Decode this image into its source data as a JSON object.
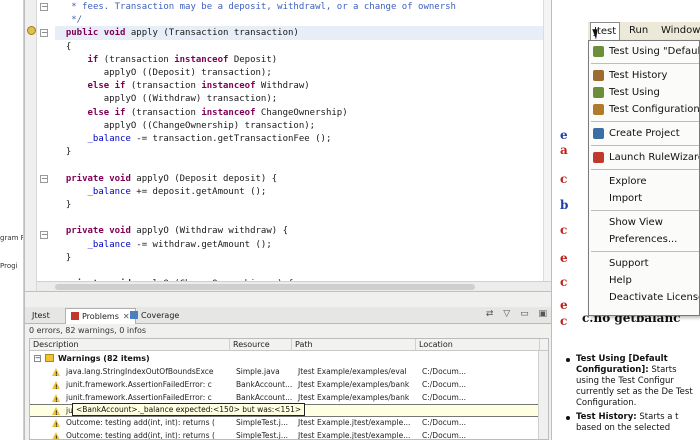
{
  "left_strip": {
    "text1": "gram F",
    "text2": "Progi"
  },
  "editor": {
    "lines": [
      [
        {
          "t": "   ",
          "c": ""
        },
        {
          "t": "* fees. Transaction may be a deposit, withdrawl, or a change of ownersh",
          "c": "cm"
        }
      ],
      [
        {
          "t": "   ",
          "c": ""
        },
        {
          "t": "*/",
          "c": "cm"
        }
      ],
      [
        {
          "t": "  ",
          "c": ""
        },
        {
          "t": "public void",
          "c": "kw"
        },
        {
          "t": " apply (Transaction transaction)",
          "c": ""
        }
      ],
      [
        {
          "t": "  {",
          "c": ""
        }
      ],
      [
        {
          "t": "      ",
          "c": ""
        },
        {
          "t": "if",
          "c": "kw"
        },
        {
          "t": " (transaction ",
          "c": ""
        },
        {
          "t": "instanceof",
          "c": "kw"
        },
        {
          "t": " Deposit)",
          "c": ""
        }
      ],
      [
        {
          "t": "         applyO ((Deposit) transaction);",
          "c": ""
        }
      ],
      [
        {
          "t": "      ",
          "c": ""
        },
        {
          "t": "else if",
          "c": "kw"
        },
        {
          "t": " (transaction ",
          "c": ""
        },
        {
          "t": "instanceof",
          "c": "kw"
        },
        {
          "t": " Withdraw)",
          "c": ""
        }
      ],
      [
        {
          "t": "         applyO ((Withdraw) transaction);",
          "c": ""
        }
      ],
      [
        {
          "t": "      ",
          "c": ""
        },
        {
          "t": "else if",
          "c": "kw"
        },
        {
          "t": " (transaction ",
          "c": ""
        },
        {
          "t": "instanceof",
          "c": "kw"
        },
        {
          "t": " ChangeOwnership)",
          "c": ""
        }
      ],
      [
        {
          "t": "         applyO ((ChangeOwnership) transaction);",
          "c": ""
        }
      ],
      [
        {
          "t": "      ",
          "c": ""
        },
        {
          "t": "_balance",
          "c": "fld"
        },
        {
          "t": " -= transaction.getTransactionFee ();",
          "c": ""
        }
      ],
      [
        {
          "t": "  }",
          "c": ""
        }
      ],
      [
        {
          "t": "",
          "c": ""
        }
      ],
      [
        {
          "t": "  ",
          "c": ""
        },
        {
          "t": "private void",
          "c": "kw"
        },
        {
          "t": " applyO (Deposit deposit) {",
          "c": ""
        }
      ],
      [
        {
          "t": "      ",
          "c": ""
        },
        {
          "t": "_balance",
          "c": "fld"
        },
        {
          "t": " += deposit.getAmount ();",
          "c": ""
        }
      ],
      [
        {
          "t": "  }",
          "c": ""
        }
      ],
      [
        {
          "t": "",
          "c": ""
        }
      ],
      [
        {
          "t": "  ",
          "c": ""
        },
        {
          "t": "private void",
          "c": "kw"
        },
        {
          "t": " applyO (Withdraw withdraw) {",
          "c": ""
        }
      ],
      [
        {
          "t": "      ",
          "c": ""
        },
        {
          "t": "_balance",
          "c": "fld"
        },
        {
          "t": " -= withdraw.getAmount ();",
          "c": ""
        }
      ],
      [
        {
          "t": "  }",
          "c": ""
        }
      ],
      [
        {
          "t": "",
          "c": ""
        }
      ],
      [
        {
          "t": "  ",
          "c": ""
        },
        {
          "t": "private void",
          "c": "kw"
        },
        {
          "t": " applyO (ChangeOwnership co) {",
          "c": ""
        }
      ]
    ]
  },
  "problems_view": {
    "tabs": [
      "Jtest",
      "Problems",
      "Coverage"
    ],
    "summary": "0 errors, 82 warnings, 0 infos",
    "columns": [
      "Description",
      "Resource",
      "Path",
      "Location"
    ],
    "group_label": "Warnings (82 items)",
    "rows": [
      [
        "java.lang.StringIndexOutOfBoundsExce",
        "Simple.java",
        "Jtest Example/examples/eval",
        "C:/Docum..."
      ],
      [
        "junit.framework.AssertionFailedError: c",
        "BankAccount...",
        "Jtest Example/examples/bank",
        "C:/Docum..."
      ],
      [
        "junit.framework.AssertionFailedError: c",
        "BankAccount...",
        "Jtest Example/examples/bank",
        "C:/Docum..."
      ],
      [
        "junit.framework.AssertionFailedError:",
        "",
        "",
        ""
      ],
      [
        "Outcome: testing add(int, int): returns (",
        "SimpleTest.j...",
        "Jtest Example.jtest/example...",
        "C:/Docum..."
      ],
      [
        "Outcome: testing add(int, int): returns (",
        "SimpleTest.j...",
        "Jtest Example.jtest/example...",
        "C:/Docum..."
      ]
    ],
    "tooltip": "<BankAccount>._balance expected:<150> but was:<151>"
  },
  "doc": {
    "code_fragments": [
      "e",
      "a",
      "c",
      "b",
      "c",
      "e",
      "c",
      "e",
      "c",
      "e",
      "c",
      "c",
      "c",
      "c.no getbalanc"
    ],
    "list": [
      {
        "bold": "Test Using [Default Configuration]:",
        "text": " Starts using the Test Configur currently set as the De Test Configuration."
      },
      {
        "bold": "Test History:",
        "text": " Starts a t based on the selected"
      }
    ]
  },
  "menubar": {
    "items": [
      "Jtest",
      "Run",
      "Window"
    ]
  },
  "menu": {
    "items": [
      {
        "label": "Test Using \"Default",
        "icon": "test-icon",
        "color": "#6b8e3a"
      },
      {
        "sep": true
      },
      {
        "label": "Test History",
        "icon": "history-icon",
        "color": "#9c6b30"
      },
      {
        "label": "Test Using",
        "icon": "test-using-icon",
        "color": "#6b8e3a"
      },
      {
        "label": "Test Configurations",
        "icon": "config-icon",
        "color": "#b07a2a"
      },
      {
        "sep": true
      },
      {
        "label": "Create Project",
        "icon": "project-icon",
        "color": "#3a6ea5"
      },
      {
        "sep": true
      },
      {
        "label": "Launch RuleWizard",
        "icon": "wizard-icon",
        "color": "#c03a2b"
      },
      {
        "sep": true
      },
      {
        "label": "Explore"
      },
      {
        "label": "Import"
      },
      {
        "sep": true
      },
      {
        "label": "Show View"
      },
      {
        "label": "Preferences..."
      },
      {
        "sep": true
      },
      {
        "label": "Support"
      },
      {
        "label": "Help"
      },
      {
        "label": "Deactivate License"
      }
    ]
  }
}
